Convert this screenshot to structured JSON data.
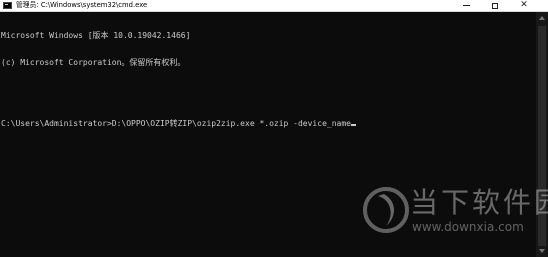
{
  "window": {
    "title": "管理员: C:\\Windows\\system32\\cmd.exe",
    "icon": "cmd-icon",
    "controls": {
      "minimize": "minimize-icon",
      "maximize": "maximize-icon",
      "close": "close-icon",
      "close_glyph": "✕"
    }
  },
  "console": {
    "lines": [
      "Microsoft Windows [版本 10.0.19042.1466]",
      "(c) Microsoft Corporation。保留所有权利。",
      "C:\\Users\\Administrator>D:\\OPPO\\OZIP转ZIP\\ozip2zip.exe *.ozip -device_name"
    ],
    "text_color": "#cccccc",
    "background": "#0c0c0c"
  },
  "watermark": {
    "text": "当下软件园",
    "url": "www.downxia.com"
  }
}
